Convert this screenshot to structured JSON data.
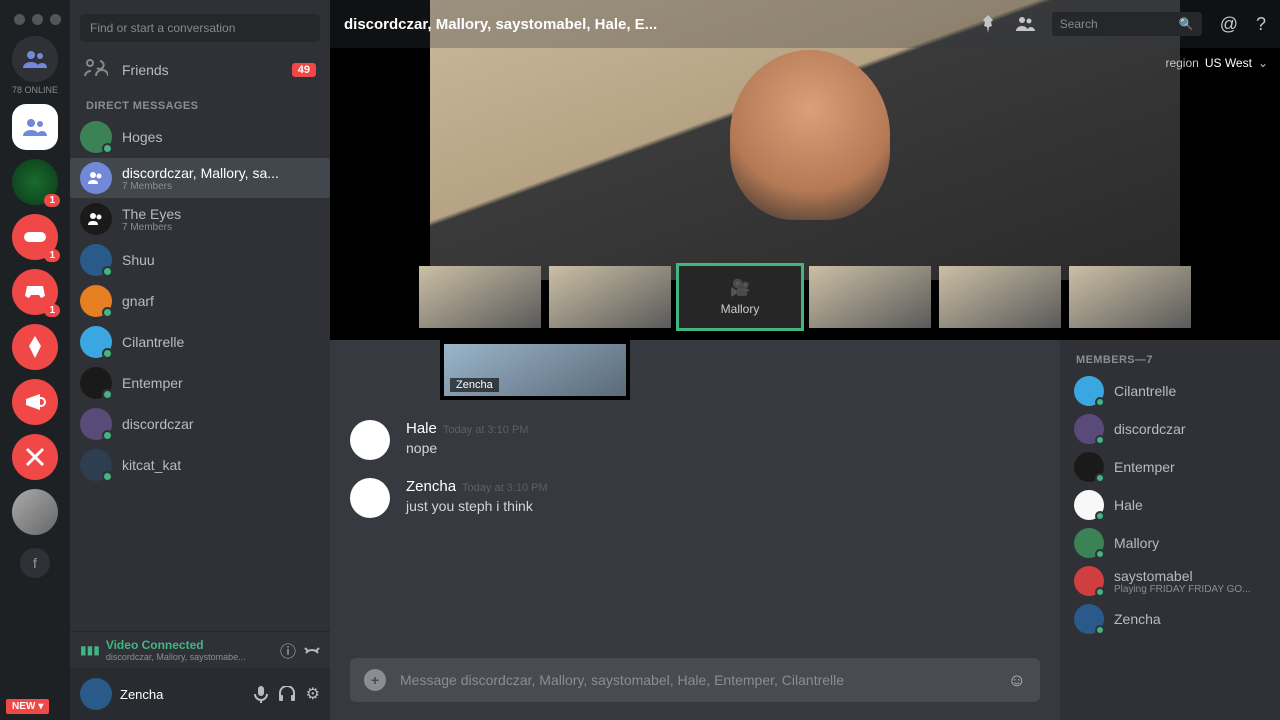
{
  "rail": {
    "online_label": "78 ONLINE",
    "servers": [
      {
        "name": "friends-home",
        "color": "#2f3136",
        "badge": null
      },
      {
        "name": "server-white",
        "color": "#ffffff",
        "badge": null,
        "selected": true
      },
      {
        "name": "server-green-mask",
        "color": "#1a6b2f",
        "badge": "1"
      },
      {
        "name": "server-gamepad",
        "color": "#f04747",
        "badge": "1"
      },
      {
        "name": "server-discord",
        "color": "#f04747",
        "badge": "1"
      },
      {
        "name": "server-pen",
        "color": "#f04747",
        "badge": null
      },
      {
        "name": "server-megaphone",
        "color": "#f04747",
        "badge": null
      },
      {
        "name": "server-tools",
        "color": "#f04747",
        "badge": null
      },
      {
        "name": "server-grey",
        "color": "#808080",
        "badge": null
      }
    ],
    "add_label": "f",
    "new_label": "NEW"
  },
  "col2": {
    "search_placeholder": "Find or start a conversation",
    "friends_label": "Friends",
    "friends_badge": "49",
    "dm_header": "DIRECT MESSAGES",
    "dms": [
      {
        "name": "Hoges",
        "sub": "",
        "av": "av-c7",
        "sel": false,
        "online": true
      },
      {
        "name": "discordczar, Mallory, sa...",
        "sub": "7 Members",
        "av": "av-c2",
        "sel": true,
        "online": false,
        "group": true
      },
      {
        "name": "The Eyes",
        "sub": "7 Members",
        "av": "av-c3",
        "sel": false,
        "online": false,
        "group": true
      },
      {
        "name": "Shuu",
        "sub": "",
        "av": "av-c9",
        "sel": false,
        "online": true
      },
      {
        "name": "gnarf",
        "sub": "",
        "av": "av-c5",
        "sel": false,
        "online": true
      },
      {
        "name": "Cilantrelle",
        "sub": "",
        "av": "av-c1",
        "sel": false,
        "online": true
      },
      {
        "name": "Entemper",
        "sub": "",
        "av": "av-c3",
        "sel": false,
        "online": true
      },
      {
        "name": "discordczar",
        "sub": "",
        "av": "av-c8",
        "sel": false,
        "online": true
      },
      {
        "name": "kitcat_kat",
        "sub": "",
        "av": "av-c6",
        "sel": false,
        "online": true
      }
    ],
    "voice_title": "Video Connected",
    "voice_sub": "discordczar, Mallory, saystomabe...",
    "user_name": "Zencha"
  },
  "topbar": {
    "title": "discordczar, Mallory, saystomabel, Hale, E...",
    "search_placeholder": "Search",
    "region_label": "region",
    "region_value": "US West"
  },
  "video": {
    "thumbs": [
      {
        "name": "participant-1"
      },
      {
        "name": "participant-2"
      },
      {
        "name": "Mallory",
        "self": true
      },
      {
        "name": "participant-4"
      },
      {
        "name": "participant-5"
      },
      {
        "name": "participant-6"
      }
    ],
    "mini_label": "Zencha"
  },
  "chat": {
    "messages": [
      {
        "author": "Hale",
        "ts": "Today at 3:10 PM",
        "text": "nope",
        "av": "av-c4"
      },
      {
        "author": "Zencha",
        "ts": "Today at 3:10 PM",
        "text": "just you steph i think",
        "av": "av-c9"
      }
    ],
    "compose_placeholder": "Message discordczar, Mallory, saystomabel, Hale, Entemper, Cilantrelle"
  },
  "members": {
    "header": "MEMBERS—7",
    "list": [
      {
        "name": "Cilantrelle",
        "av": "av-c1",
        "online": true
      },
      {
        "name": "discordczar",
        "av": "av-c8",
        "online": true
      },
      {
        "name": "Entemper",
        "av": "av-c3",
        "online": true
      },
      {
        "name": "Hale",
        "av": "av-c4",
        "online": true
      },
      {
        "name": "Mallory",
        "av": "av-c7",
        "online": true
      },
      {
        "name": "saystomabel",
        "av": "av-c10",
        "online": true,
        "status": "Playing FRIDAY FRIDAY GO..."
      },
      {
        "name": "Zencha",
        "av": "av-c9",
        "online": true
      }
    ]
  }
}
